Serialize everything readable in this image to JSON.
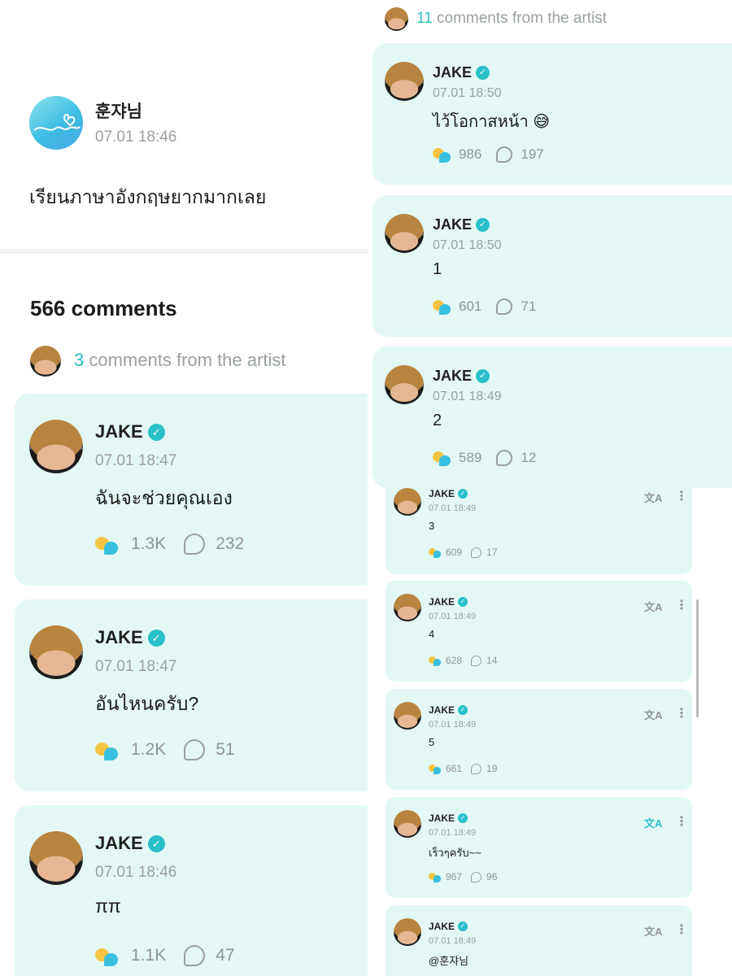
{
  "post": {
    "author": "훈쟈님",
    "time": "07.01 18:46",
    "text": "เรียนภาษาอังกฤษยากมากเลย"
  },
  "comments_header": {
    "count_text": "566 comments",
    "artist_count": "3",
    "artist_suffix": "comments from the artist"
  },
  "left_comments": [
    {
      "name": "JAKE",
      "time": "07.01 18:47",
      "text": "ฉันจะช่วยคุณเอง",
      "likes": "1.3K",
      "replies": "232"
    },
    {
      "name": "JAKE",
      "time": "07.01 18:47",
      "text": "อันไหนครับ?",
      "likes": "1.2K",
      "replies": "51"
    },
    {
      "name": "JAKE",
      "time": "07.01 18:46",
      "text": "ππ",
      "likes": "1.1K",
      "replies": "47"
    }
  ],
  "right_header": {
    "artist_count": "11",
    "artist_suffix": "comments from the artist"
  },
  "right_comments": [
    {
      "name": "JAKE",
      "time": "07.01 18:50",
      "text": "ไว้โอกาสหน้า 😅",
      "likes": "986",
      "replies": "197"
    },
    {
      "name": "JAKE",
      "time": "07.01 18:50",
      "text": "1",
      "likes": "601",
      "replies": "71"
    },
    {
      "name": "JAKE",
      "time": "07.01 18:49",
      "text": "2",
      "likes": "589",
      "replies": "12"
    }
  ],
  "small_comments": [
    {
      "name": "JAKE",
      "time": "07.01 18:49",
      "text": "3",
      "likes": "609",
      "replies": "17"
    },
    {
      "name": "JAKE",
      "time": "07.01 18:49",
      "text": "4",
      "likes": "628",
      "replies": "14"
    },
    {
      "name": "JAKE",
      "time": "07.01 18:49",
      "text": "5",
      "likes": "661",
      "replies": "19"
    },
    {
      "name": "JAKE",
      "time": "07.01 18:49",
      "text": "เร็วๆครับ~~",
      "likes": "967",
      "replies": "96"
    },
    {
      "name": "JAKE",
      "time": "07.01 18:49",
      "text": "@훈쟈님",
      "likes": "",
      "replies": ""
    }
  ],
  "icons": {
    "verified": "✓",
    "translate": "文A",
    "more": "⋮"
  },
  "colors": {
    "accent": "#2ac0c9",
    "card_background": "#e3f8f5",
    "muted_text": "#9aa0a0"
  }
}
